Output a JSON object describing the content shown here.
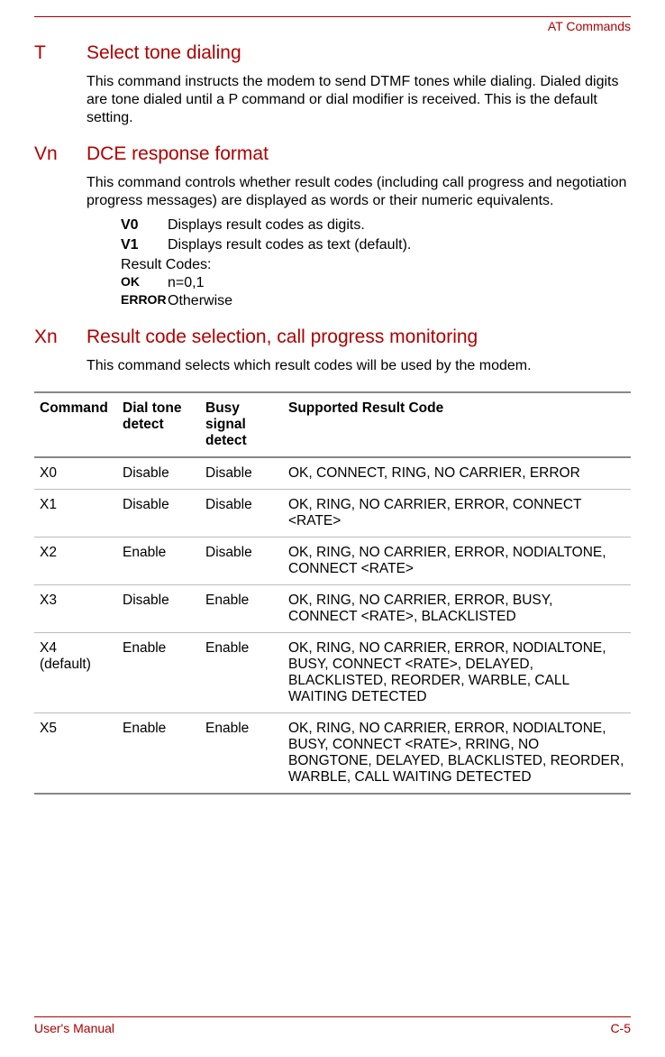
{
  "header": {
    "right_label": "AT Commands"
  },
  "sections": {
    "t": {
      "code": "T",
      "title": "Select tone dialing",
      "body": "This command instructs the modem to send DTMF tones while dialing. Dialed digits are tone dialed until a P command or dial modifier is received. This is the default setting."
    },
    "vn": {
      "code": "Vn",
      "title": "DCE response format",
      "body": "This command controls whether result codes (including call progress and negotiation progress messages) are displayed as words or their numeric equivalents.",
      "opts": {
        "v0": {
          "key": "V0",
          "desc": "Displays result codes as digits."
        },
        "v1": {
          "key": "V1",
          "desc": "Displays result codes as text (default)."
        }
      },
      "result_label": "Result Codes:",
      "result_ok_key": "OK",
      "result_ok_val": "n=0,1",
      "result_err_key": "ERROR",
      "result_err_val": "Otherwise"
    },
    "xn": {
      "code": "Xn",
      "title": "Result code selection, call progress monitoring",
      "body": "This command selects which result codes will be used by the modem."
    }
  },
  "table": {
    "headers": {
      "command": "Command",
      "dial1": "Dial tone",
      "dial2": "detect",
      "busy1": "Busy signal",
      "busy2": "detect",
      "supported": "Supported Result Code"
    },
    "rows": [
      {
        "command": "X0",
        "dial": "Disable",
        "busy": "Disable",
        "supported": "OK, CONNECT, RING, NO CARRIER, ERROR"
      },
      {
        "command": "X1",
        "dial": "Disable",
        "busy": "Disable",
        "supported": "OK, RING, NO CARRIER, ERROR, CONNECT <RATE>"
      },
      {
        "command": "X2",
        "dial": "Enable",
        "busy": "Disable",
        "supported": "OK, RING, NO CARRIER, ERROR, NODIALTONE, CONNECT <RATE>"
      },
      {
        "command": "X3",
        "dial": "Disable",
        "busy": "Enable",
        "supported": "OK, RING, NO CARRIER, ERROR, BUSY, CONNECT <RATE>, BLACKLISTED"
      },
      {
        "command": "X4 (default)",
        "dial": "Enable",
        "busy": "Enable",
        "supported": "OK, RING, NO CARRIER, ERROR, NODIALTONE, BUSY, CONNECT <RATE>, DELAYED, BLACKLISTED, REORDER, WARBLE, CALL WAITING DETECTED"
      },
      {
        "command": "X5",
        "dial": "Enable",
        "busy": "Enable",
        "supported": "OK, RING, NO CARRIER, ERROR, NODIALTONE, BUSY, CONNECT <RATE>, RRING, NO BONGTONE, DELAYED, BLACKLISTED, REORDER, WARBLE, CALL WAITING DETECTED"
      }
    ]
  },
  "footer": {
    "left": "User's Manual",
    "right": "C-5"
  }
}
